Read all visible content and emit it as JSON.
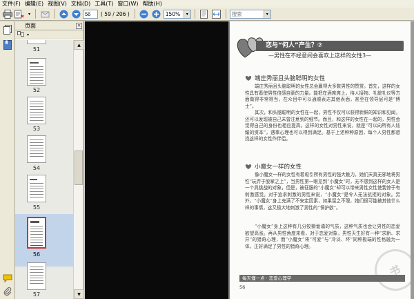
{
  "menu": [
    "文件(F)",
    "编辑(E)",
    "视图(V)",
    "文档(D)",
    "工具(T)",
    "窗口(W)",
    "帮助(H)"
  ],
  "toolbar": {
    "page_current": "56",
    "page_of": "( 59 / 206 )",
    "zoom": "150%",
    "search_placeholder": "搜索"
  },
  "panel": {
    "title": "页面",
    "close": "×"
  },
  "thumbnails": [
    {
      "label": "51"
    },
    {
      "label": "52"
    },
    {
      "label": "53"
    },
    {
      "label": "54"
    },
    {
      "label": "55"
    },
    {
      "label": "56"
    },
    {
      "label": "57"
    }
  ],
  "page": {
    "chapter_title": "恋与“何人”产生？⑦",
    "chapter_subtitle": "—男性在不经意间会喜欢上这样的女性3—",
    "section1_title": "端庄秀丽且头脑聪明的女性",
    "section1_paras": [
      "端庄秀丽且头脑聪明的女性总会赢得大多数男性的赞赏。首先，这样的女性具有着使男性倍感自豪的力量。能把在酒席席上，待人接物、礼貌礼仪等方面做得非常得当，在众目中可以通顺表达其他表面，甚至在领导层可是“博士”。",
      "其次，和头脑聪明的女性在一起，男性不仅可以获得新鲜的知识和见闻，还可以发现被自己未曾注意到的细节。而且，和这样的女性在一起的，男性会觉得自己的身份也相应提高。这样的女性对男性来说，就是“可以向所有人炫耀的资本”，遇事心理也可以得到满足。基于上述种种原因，每个人男性都想找这样的女性作伴侣。"
    ],
    "section2_title": "小魔女一样的女性",
    "section2_paras": [
      "像小魔女一样的女性有着吸引所有男性的强大魅力。她们天真无邪地将男性“玩弄于股掌之上”，当男性第一眼见到“小魔女”时，无不感到这样的女人是一个具挑战的对象，但是，被征服的“小魔女”却可以带来男性女性使我惊于有刺激感觉。对于追求刺激的男性来说，“小魔女”是令人无法抗拒的对象。另外，“小魔女”身上充满了不安定因素，如果留之不理，她们很可能被其他什么样的事情，这又极大地刺激了男性的“保护欲”。",
      "“小魔女”身上这种有几分狡猾诡谲的气质，这种气质也会让男性的恋爱欲望高涨。再从男性角度来看，对于恋爱对象，男性天生好有一种“求新、求异”的猎奇心理，而“小魔女”将“可爱”与“冷淡、坏”同种极端的性格融为一体，正好满足了男性的猎奇心理。"
    ],
    "footer_text": "每天懂一点 · 恋爱心理学",
    "page_number": "56",
    "watermark": "书"
  },
  "colors": {
    "selection": "#c2d4ea",
    "selected_border": "#cc3333",
    "title_bar": "#5b5b5b"
  },
  "icons": [
    "print-icon",
    "save-icon",
    "page-up-icon",
    "page-down-icon",
    "zoom-out-icon",
    "zoom-in-icon",
    "fit-page-icon",
    "fit-width-icon",
    "pages-panel-icon",
    "bookmarks-icon",
    "comments-icon",
    "attachments-icon"
  ]
}
